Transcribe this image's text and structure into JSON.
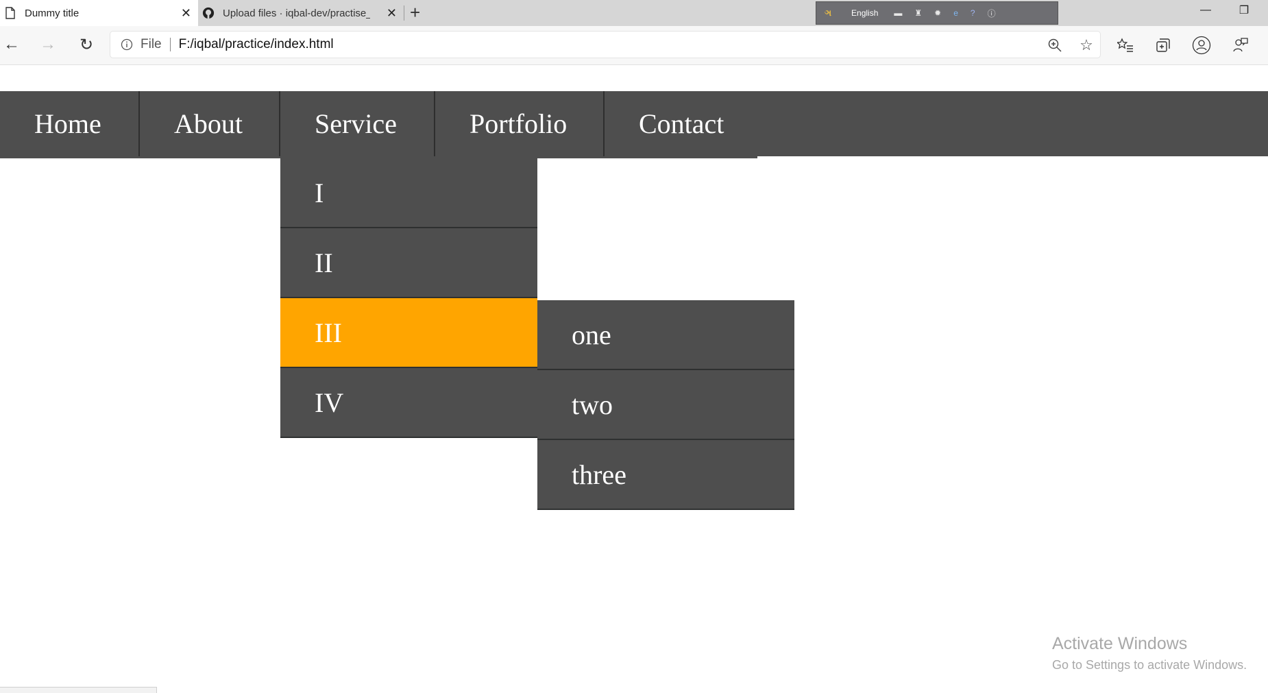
{
  "browser": {
    "tabs": [
      {
        "title": "Dummy title",
        "icon": "page-icon",
        "active": true
      },
      {
        "title": "Upload files · iqbal-dev/practise_",
        "icon": "github-icon",
        "active": false
      }
    ],
    "ime": {
      "language": "English"
    },
    "address": {
      "scheme": "File",
      "url": "F:/iqbal/practice/index.html"
    }
  },
  "nav": {
    "items": [
      {
        "label": "Home"
      },
      {
        "label": "About"
      },
      {
        "label": "Service"
      },
      {
        "label": "Portfolio"
      },
      {
        "label": "Contact"
      }
    ],
    "dropdown": [
      "I",
      "II",
      "III",
      "IV"
    ],
    "dropdown_active_index": 2,
    "submenu": [
      "one",
      "two",
      "three"
    ]
  },
  "watermark": {
    "line1": "Activate Windows",
    "line2": "Go to Settings to activate Windows."
  },
  "colors": {
    "nav_bg": "#4e4e4e",
    "active_bg": "#ffa500",
    "text": "#ffffff"
  }
}
